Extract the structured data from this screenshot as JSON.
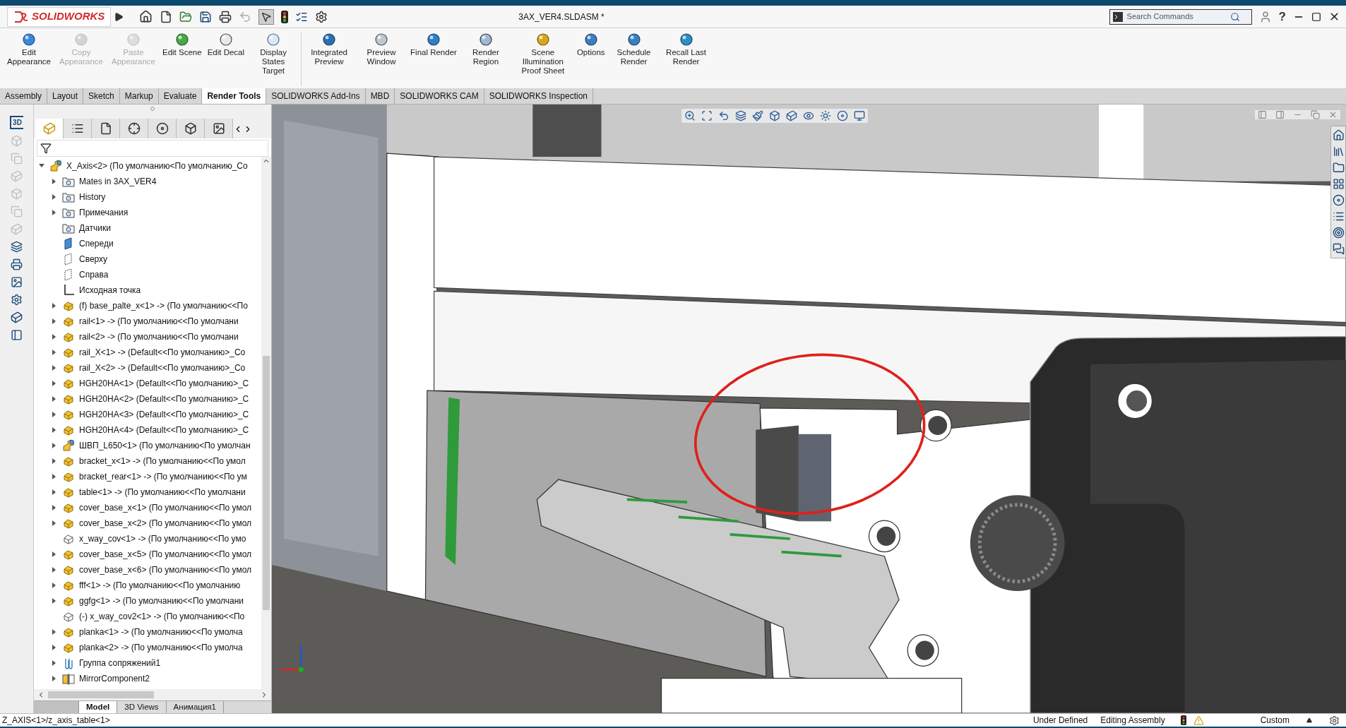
{
  "title_bar": {
    "logo": "SOLIDWORKS",
    "document_title": "3AX_VER4.SLDASM *",
    "search": {
      "placeholder": "Search Commands"
    },
    "help": "?"
  },
  "ribbon": {
    "commands": [
      {
        "label": "Edit Appearance",
        "disabled": false
      },
      {
        "label": "Copy Appearance",
        "disabled": true
      },
      {
        "label": "Paste Appearance",
        "disabled": true
      },
      {
        "label": "Edit Scene",
        "disabled": false
      },
      {
        "label": "Edit Decal",
        "disabled": false
      },
      {
        "label": "Display States Target",
        "disabled": false
      },
      {
        "label": "Integrated Preview",
        "disabled": false
      },
      {
        "label": "Preview Window",
        "disabled": false
      },
      {
        "label": "Final Render",
        "disabled": false
      },
      {
        "label": "Render Region",
        "disabled": false
      },
      {
        "label": "Scene Illumination Proof Sheet",
        "disabled": false
      },
      {
        "label": "Options",
        "disabled": false
      },
      {
        "label": "Schedule Render",
        "disabled": false
      },
      {
        "label": "Recall Last Render",
        "disabled": false
      }
    ]
  },
  "command_tabs": [
    {
      "label": "Assembly",
      "selected": false
    },
    {
      "label": "Layout",
      "selected": false
    },
    {
      "label": "Sketch",
      "selected": false
    },
    {
      "label": "Markup",
      "selected": false
    },
    {
      "label": "Evaluate",
      "selected": false
    },
    {
      "label": "Render Tools",
      "selected": true
    },
    {
      "label": "SOLIDWORKS Add-Ins",
      "selected": false
    },
    {
      "label": "MBD",
      "selected": false
    },
    {
      "label": "SOLIDWORKS CAM",
      "selected": false
    },
    {
      "label": "SOLIDWORKS Inspection",
      "selected": false
    }
  ],
  "left_toolbar": {
    "view_label": "3D"
  },
  "feature_tree": {
    "root": {
      "label": "X_Axis<2> (По умолчанию<По умолчанию_Со",
      "kind": "subassembly",
      "expanded": true,
      "children": [
        {
          "label": "Mates in 3AX_VER4",
          "kind": "mates-folder",
          "expanded": false
        },
        {
          "label": "History",
          "kind": "history-folder",
          "expanded": false
        },
        {
          "label": "Примечания",
          "kind": "annotations-folder",
          "expanded": false
        },
        {
          "label": "Датчики",
          "kind": "sensors-folder"
        },
        {
          "label": "Спереди",
          "kind": "front-plane"
        },
        {
          "label": "Сверху",
          "kind": "plane"
        },
        {
          "label": "Справа",
          "kind": "plane"
        },
        {
          "label": "Исходная точка",
          "kind": "origin"
        },
        {
          "label": "(f) base_palte_x<1> -> (По умолчанию<<По",
          "kind": "part",
          "expanded": false
        },
        {
          "label": "rail<1> -> (По умолчанию<<По умолчани",
          "kind": "part",
          "expanded": false
        },
        {
          "label": "rail<2> -> (По умолчанию<<По умолчани",
          "kind": "part",
          "expanded": false
        },
        {
          "label": "rail_X<1> -> (Default<<По умолчанию>_Со",
          "kind": "part",
          "expanded": false
        },
        {
          "label": "rail_X<2> -> (Default<<По умолчанию>_Со",
          "kind": "part",
          "expanded": false
        },
        {
          "label": "HGH20HA<1> (Default<<По умолчанию>_С",
          "kind": "part",
          "expanded": false
        },
        {
          "label": "HGH20HA<2> (Default<<По умолчанию>_С",
          "kind": "part",
          "expanded": false
        },
        {
          "label": "HGH20HA<3> (Default<<По умолчанию>_С",
          "kind": "part",
          "expanded": false
        },
        {
          "label": "HGH20HA<4> (Default<<По умолчанию>_С",
          "kind": "part",
          "expanded": false
        },
        {
          "label": "ШВП_L650<1> (По умолчанию<По умолчан",
          "kind": "subassembly",
          "expanded": false
        },
        {
          "label": "bracket_x<1> -> (По умолчанию<<По умол",
          "kind": "part",
          "expanded": false
        },
        {
          "label": "bracket_rear<1> -> (По умолчанию<<По ум",
          "kind": "part",
          "expanded": false
        },
        {
          "label": "table<1> -> (По умолчанию<<По умолчани",
          "kind": "part",
          "expanded": false
        },
        {
          "label": "cover_base_x<1> (По умолчанию<<По умол",
          "kind": "part",
          "expanded": false
        },
        {
          "label": "cover_base_x<2> (По умолчанию<<По умол",
          "kind": "part",
          "expanded": false
        },
        {
          "label": "x_way_cov<1> -> (По умолчанию<<По умо",
          "kind": "hidden-part"
        },
        {
          "label": "cover_base_x<5> (По умолчанию<<По умол",
          "kind": "part",
          "expanded": false
        },
        {
          "label": "cover_base_x<6> (По умолчанию<<По умол",
          "kind": "part",
          "expanded": false
        },
        {
          "label": "fff<1> -> (По умолчанию<<По умолчанию",
          "kind": "part",
          "expanded": false
        },
        {
          "label": "ggfg<1> -> (По умолчанию<<По умолчани",
          "kind": "part",
          "expanded": false
        },
        {
          "label": "(-) x_way_cov2<1> -> (По умолчанию<<По",
          "kind": "hidden-part"
        },
        {
          "label": "planka<1> -> (По умолчанию<<По умолча",
          "kind": "part",
          "expanded": false
        },
        {
          "label": "planka<2> -> (По умолчанию<<По умолча",
          "kind": "part",
          "expanded": false
        },
        {
          "label": "Группа сопряжений1",
          "kind": "mate-group",
          "expanded": false
        },
        {
          "label": "MirrorComponent2",
          "kind": "mirror",
          "expanded": false
        }
      ]
    }
  },
  "bottom_tabs": [
    {
      "label": "Model",
      "selected": true
    },
    {
      "label": "3D Views",
      "selected": false
    },
    {
      "label": "Анимация1",
      "selected": false
    }
  ],
  "status_bar": {
    "path": "Z_AXIS<1>/z_axis_table<1>",
    "definition": "Under Defined",
    "mode": "Editing Assembly",
    "units": "Custom"
  }
}
